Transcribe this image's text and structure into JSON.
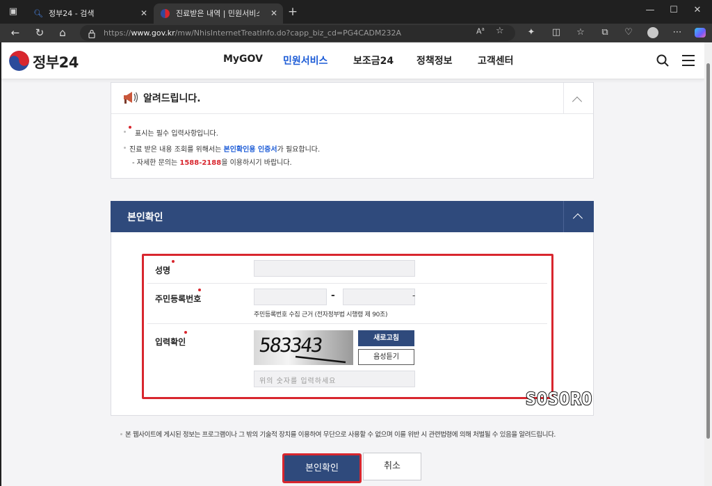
{
  "browser": {
    "tabs": [
      {
        "title": "정부24 - 검색",
        "active": false
      },
      {
        "title": "진료받은 내역 | 민원서비스 | 정부",
        "active": true
      }
    ],
    "url_prefix": "https://",
    "url_domain": "www.gov.kr",
    "url_path": "/mw/NhisInternetTreatInfo.do?capp_biz_cd=PG4CADM232A"
  },
  "site": {
    "logo_text": "정부24",
    "menu": [
      "MyGOV",
      "민원서비스",
      "보조금24",
      "정책정보",
      "고객센터"
    ],
    "active_menu_index": 1
  },
  "notice": {
    "title": "알려드립니다.",
    "line1": "표시는 필수 입력사항입니다.",
    "line2_pre": "진료 받은 내용 조회를 위해서는 ",
    "line2_link": "본인확인용 인증서",
    "line2_post": "가 필요합니다.",
    "line3_pre": "- 자세한 문의는 ",
    "line3_phone": "1588-2188",
    "line3_post": "을 이용하시기 바랍니다."
  },
  "verify": {
    "header": "본인확인",
    "name_label": "성명",
    "rrn_label": "주민등록번호",
    "rrn_dash": "-",
    "rrn_note": "주민등록번호 수집 근거 (전자정부법 시행령 제 90조)",
    "captcha_label": "입력확인",
    "captcha_text": "583343",
    "refresh_button": "새로고침",
    "audio_button": "음성듣기",
    "captcha_placeholder": "위의 숫자를 입력하세요"
  },
  "footer_notice": "본 웹사이트에 게시된 정보는 프로그램이나 그 밖의 기술적 장치를 이용하여 무단으로 사용할 수 없으며 이를 위반 시 관련법령에 의해 처벌될 수 있음을 알려드립니다.",
  "actions": {
    "confirm": "본인확인",
    "cancel": "취소"
  },
  "watermark": "SOSORO",
  "colors": {
    "navy": "#2f4a7c",
    "highlight": "#d8262e",
    "link_blue": "#1a5ad6"
  }
}
